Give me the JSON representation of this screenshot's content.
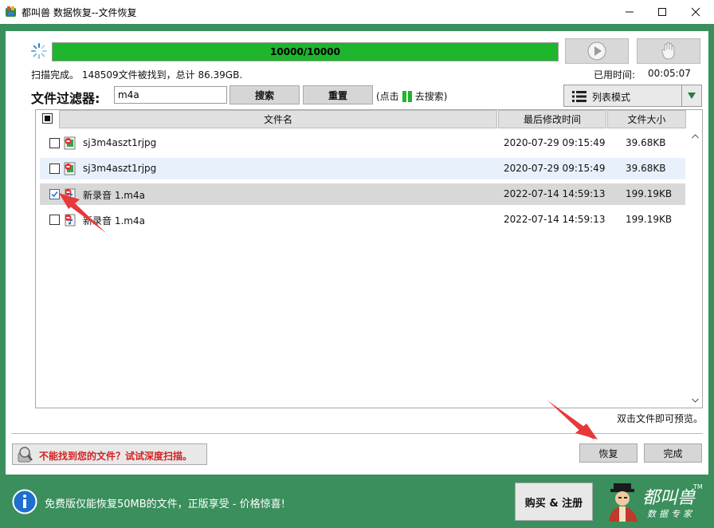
{
  "window": {
    "title": "都叫兽 数据恢复--文件恢复"
  },
  "progress": {
    "text": "10000/10000",
    "fraction": 1.0
  },
  "status": {
    "scan_summary": "扫描完成。 148509文件被找到，总计 86.39GB.",
    "elapsed_label": "已用时间:",
    "elapsed_value": "00:05:07"
  },
  "filter": {
    "label": "文件过滤器:",
    "value": "m4a",
    "search_label": "搜索",
    "reset_label": "重置",
    "hint_prefix": "(点击",
    "hint_suffix": "去搜索)"
  },
  "view": {
    "mode_label": "列表模式"
  },
  "columns": {
    "name": "文件名",
    "modified": "最后修改时间",
    "size": "文件大小"
  },
  "rows": [
    {
      "name": "sj3m4aszt1rjpg",
      "modified": "2020-07-29 09:15:49",
      "size": "39.68KB",
      "checked": false
    },
    {
      "name": "sj3m4aszt1rjpg",
      "modified": "2020-07-29 09:15:49",
      "size": "39.68KB",
      "checked": false
    },
    {
      "name": "新录音 1.m4a",
      "modified": "2022-07-14 14:59:13",
      "size": "199.19KB",
      "checked": true
    },
    {
      "name": "新录音 1.m4a",
      "modified": "2022-07-14 14:59:13",
      "size": "199.19KB",
      "checked": false
    }
  ],
  "preview_tip": "双击文件即可预览。",
  "deep_scan": {
    "label": "不能找到您的文件？试试深度扫描。"
  },
  "actions": {
    "recover_label": "恢复",
    "finish_label": "完成"
  },
  "banner": {
    "text": "免费版仅能恢复50MB的文件，正版享受 - 价格惊喜!",
    "buy_label": "购买 & 注册",
    "logo_text": "都叫兽",
    "logo_tagline": "数据专家",
    "logo_tm": "TM"
  },
  "colors": {
    "frame_green": "#3a8f5c",
    "progress_green": "#1fb52c",
    "deep_scan_red": "#d32121",
    "annotation_arrow": "#e8393a"
  },
  "icons": [
    "app-icon",
    "spinner-icon",
    "play-icon",
    "stop-icon",
    "list-view-icon",
    "dropdown-arrow-icon",
    "file-image-icon",
    "file-audio-icon",
    "magnifier-disk-icon",
    "info-icon"
  ]
}
